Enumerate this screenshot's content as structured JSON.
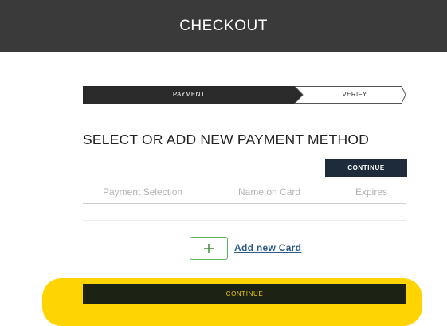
{
  "header": {
    "title": "CHECKOUT"
  },
  "steps": [
    {
      "label": "PAYMENT",
      "active": true
    },
    {
      "label": "VERIFY",
      "active": false
    }
  ],
  "main": {
    "heading": "SELECT OR ADD NEW PAYMENT METHOD",
    "continue_label": "CONTINUE",
    "columns": [
      "Payment Selection",
      "Name on Card",
      "Expires"
    ],
    "add_card_label": "Add new Card",
    "footer_continue_label": "CONTINUE"
  },
  "colors": {
    "header_bg": "#3a3a3a",
    "active_step": "#2a2a2a",
    "primary_button": "#1d2b3a",
    "highlight": "#ffd400",
    "add_border": "#5bb55b",
    "link": "#2b5a8a"
  },
  "icons": {
    "add": "plus-icon"
  }
}
